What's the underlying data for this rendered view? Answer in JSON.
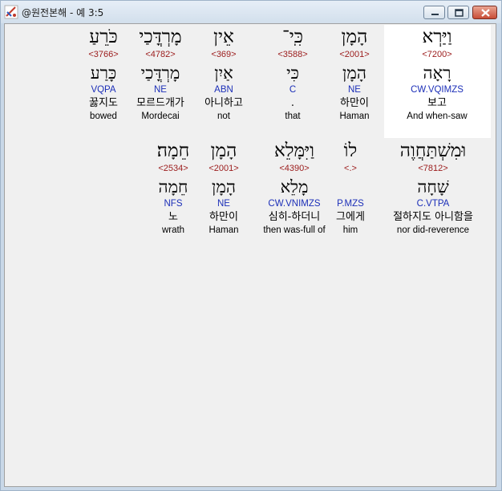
{
  "window": {
    "title": "@원전본해 - 예 3:5"
  },
  "rows": [
    [
      {
        "heb": "וַיַּרְא",
        "strong": "<7200>",
        "lemma": "רָאָה",
        "parse": "CW.VQIMZS",
        "korean": "보고",
        "english": "And when-saw"
      },
      {
        "heb": "הָמָן",
        "strong": "<2001>",
        "lemma": "הָמָן",
        "parse": "NE",
        "korean": "하만이",
        "english": "Haman"
      },
      {
        "heb": "כִּֽי־",
        "strong": "<3588>",
        "lemma": "כִּי",
        "parse": "C",
        "korean": ".",
        "english": "that"
      },
      {
        "heb": "אֵין",
        "strong": "<369>",
        "lemma": "אַיִן",
        "parse": "ABN",
        "korean": "아니하고",
        "english": "not"
      },
      {
        "heb": "מָרְדֳּכַי",
        "strong": "<4782>",
        "lemma": "מָרְדֳּכַי",
        "parse": "NE",
        "korean": "모르드개가",
        "english": "Mordecai"
      },
      {
        "heb": "כֹּרֵעַ",
        "strong": "<3766>",
        "lemma": "כָּרַע",
        "parse": "VQPA",
        "korean": "꿇지도",
        "english": "bowed"
      }
    ],
    [
      {
        "heb": "וּמִשְׁתַּחֲוֶה",
        "strong": "<7812>",
        "lemma": "שָׁחָה",
        "parse": "C.VTPA",
        "korean": "절하지도 아니함을",
        "english": "nor did-reverence"
      },
      {
        "heb": "לוֹ",
        "strong": "<.>",
        "lemma": "",
        "parse": "P.MZS",
        "korean": "그에게",
        "english": "him"
      },
      {
        "heb": "וַיִּמָּלֵא",
        "strong": "<4390>",
        "lemma": "מָלֵא",
        "parse": "CW.VNIMZS",
        "korean": "심히-하더니",
        "english": "then was-full of"
      },
      {
        "heb": "הָמָן",
        "strong": "<2001>",
        "lemma": "הָמָן",
        "parse": "NE",
        "korean": "하만이",
        "english": "Haman"
      },
      {
        "heb": "חֵמָה׃",
        "strong": "<2534>",
        "lemma": "חֵמָה",
        "parse": "NFS",
        "korean": "노",
        "english": "wrath"
      }
    ]
  ]
}
